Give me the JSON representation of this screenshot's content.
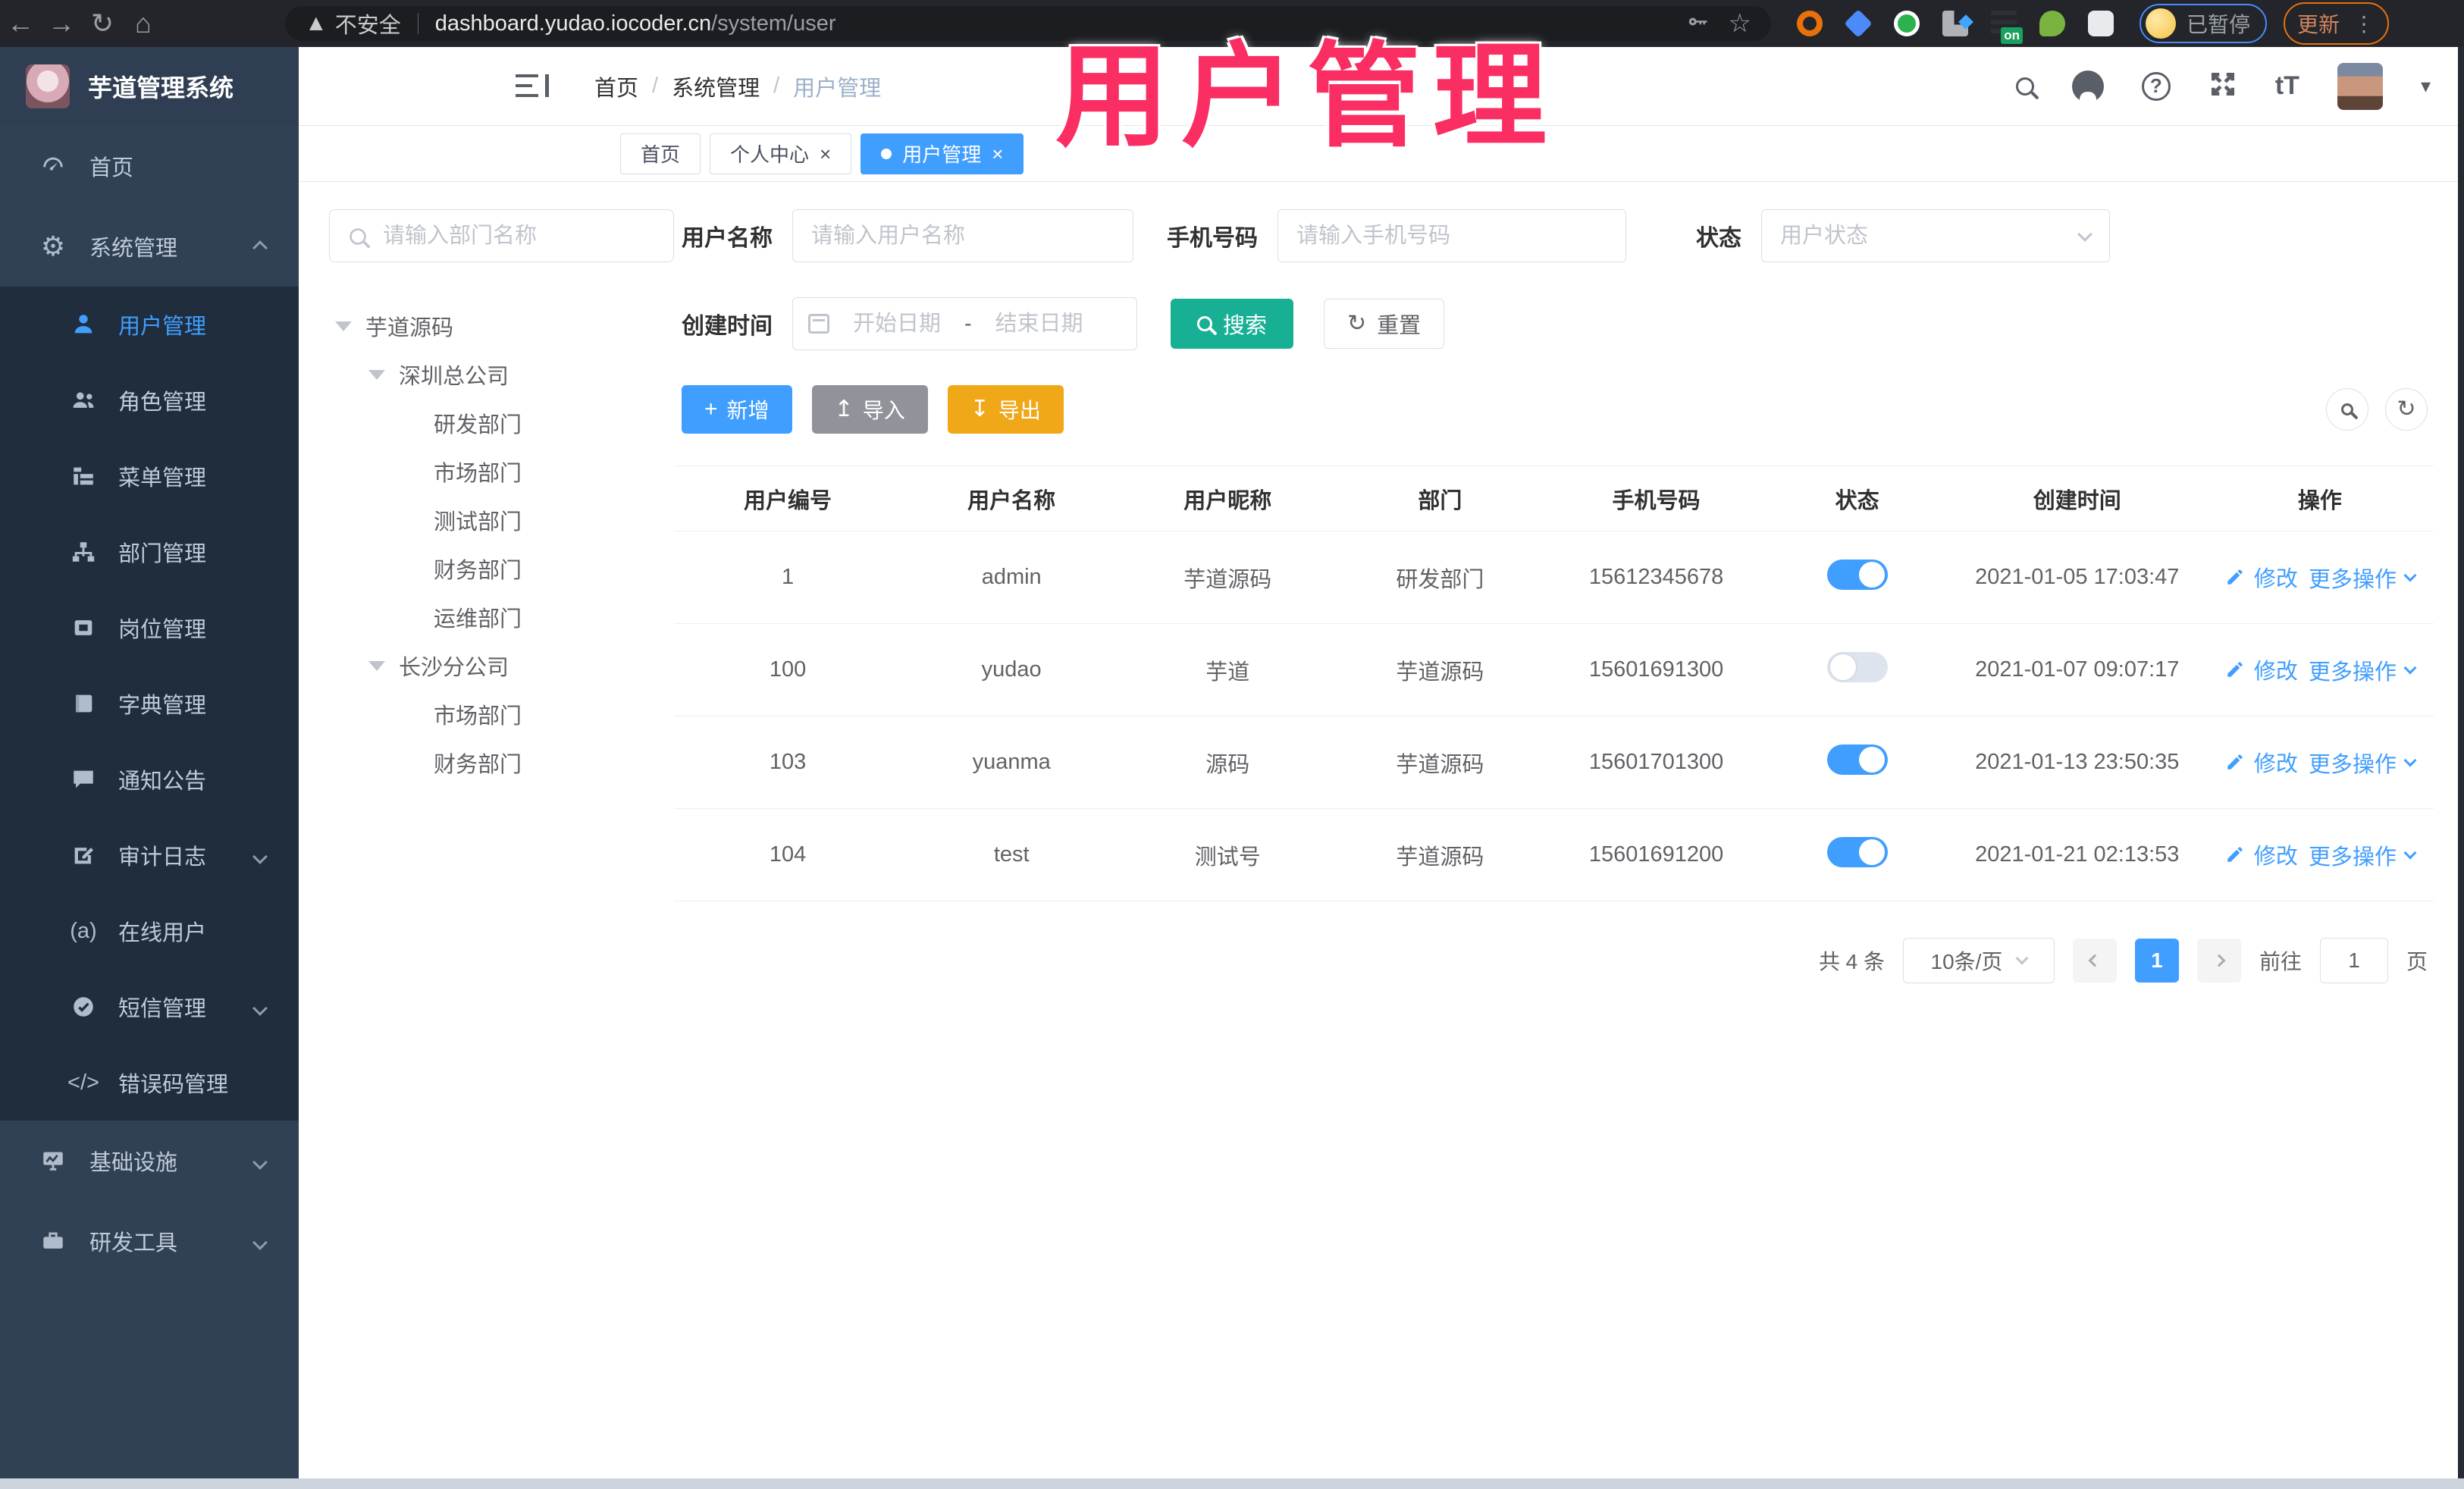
{
  "browser": {
    "not_secure": "不安全",
    "url_host": "dashboard.yudao.iocoder.cn",
    "url_path": "/system/user",
    "ext_on_badge": "on",
    "paused_badge": "已暂停",
    "update_button": "更新"
  },
  "overlay": {
    "title": "用户管理",
    "color": "#fb2e63"
  },
  "header": {
    "logo_title": "芋道管理系统",
    "breadcrumb": {
      "home": "首页",
      "section": "系统管理",
      "current": "用户管理"
    },
    "font_icon_label": "tT"
  },
  "tabs": {
    "home": "首页",
    "profile": "个人中心",
    "current": "用户管理"
  },
  "sidebar": {
    "items": [
      {
        "label": "首页"
      },
      {
        "label": "系统管理"
      },
      {
        "label": "基础设施"
      },
      {
        "label": "研发工具"
      }
    ],
    "submenu": [
      {
        "label": "用户管理"
      },
      {
        "label": "角色管理"
      },
      {
        "label": "菜单管理"
      },
      {
        "label": "部门管理"
      },
      {
        "label": "岗位管理"
      },
      {
        "label": "字典管理"
      },
      {
        "label": "通知公告"
      },
      {
        "label": "审计日志"
      },
      {
        "label": "在线用户"
      },
      {
        "label": "短信管理"
      },
      {
        "label": "错误码管理"
      }
    ],
    "code_glyph": "</>",
    "online_glyph": "(a)"
  },
  "tree": {
    "search_placeholder": "请输入部门名称",
    "root": "芋道源码",
    "branch1": {
      "label": "深圳总公司",
      "children": [
        "研发部门",
        "市场部门",
        "测试部门",
        "财务部门",
        "运维部门"
      ]
    },
    "branch2": {
      "label": "长沙分公司",
      "children": [
        "市场部门",
        "财务部门"
      ]
    }
  },
  "filters": {
    "username_label": "用户名称",
    "username_placeholder": "请输入用户名称",
    "mobile_label": "手机号码",
    "mobile_placeholder": "请输入手机号码",
    "status_label": "状态",
    "status_placeholder": "用户状态",
    "createtime_label": "创建时间",
    "date_start_placeholder": "开始日期",
    "date_separator": "-",
    "date_end_placeholder": "结束日期",
    "search_button": "搜索",
    "reset_button": "重置"
  },
  "toolbar": {
    "add_label": "新增",
    "import_label": "导入",
    "export_label": "导出"
  },
  "table": {
    "columns": [
      "用户编号",
      "用户名称",
      "用户昵称",
      "部门",
      "手机号码",
      "状态",
      "创建时间",
      "操作"
    ],
    "edit_label": "修改",
    "more_label": "更多操作",
    "rows": [
      {
        "id": "1",
        "username": "admin",
        "nickname": "芋道源码",
        "dept": "研发部门",
        "mobile": "15612345678",
        "status": "on",
        "created": "2021-01-05 17:03:47"
      },
      {
        "id": "100",
        "username": "yudao",
        "nickname": "芋道",
        "dept": "芋道源码",
        "mobile": "15601691300",
        "status": "off",
        "created": "2021-01-07 09:07:17"
      },
      {
        "id": "103",
        "username": "yuanma",
        "nickname": "源码",
        "dept": "芋道源码",
        "mobile": "15601701300",
        "status": "on",
        "created": "2021-01-13 23:50:35"
      },
      {
        "id": "104",
        "username": "test",
        "nickname": "测试号",
        "dept": "芋道源码",
        "mobile": "15601691200",
        "status": "on",
        "created": "2021-01-21 02:13:53"
      }
    ]
  },
  "pagination": {
    "total": "共 4 条",
    "page_size": "10条/页",
    "current_page": "1",
    "goto_label": "前往",
    "goto_value": "1",
    "page_unit": "页"
  },
  "colors": {
    "accent": "#409eff",
    "search_teal": "#17b095",
    "export_orange": "#f0a818",
    "sidebar_bg": "#304156",
    "submenu_bg": "#1f2d3d",
    "annotation_pink": "#fb2e63"
  }
}
